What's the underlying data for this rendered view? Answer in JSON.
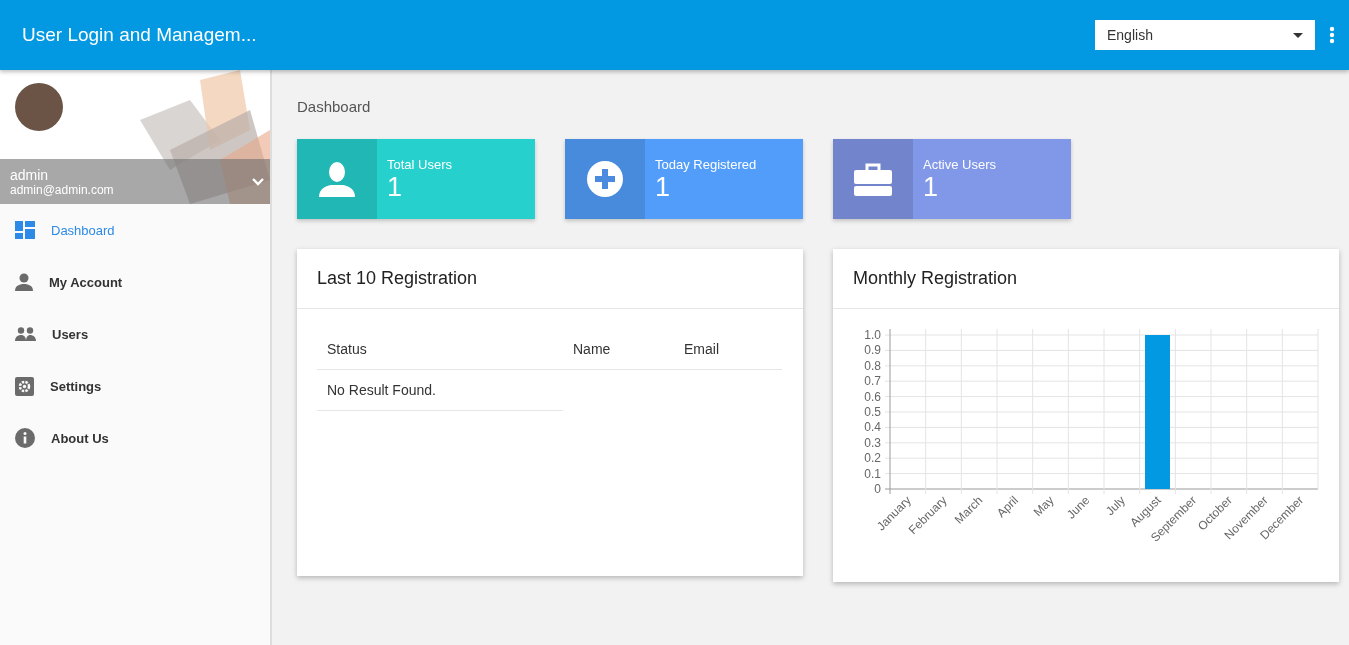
{
  "app_bar": {
    "title": "User Login and Managem...",
    "language": "English"
  },
  "profile": {
    "name": "admin",
    "email": "admin@admin.com"
  },
  "sidebar": {
    "items": [
      {
        "label": "Dashboard",
        "kind": "dashboard",
        "selected": true
      },
      {
        "label": "My Account",
        "kind": "person",
        "selected": false
      },
      {
        "label": "Users",
        "kind": "people",
        "selected": false
      },
      {
        "label": "Settings",
        "kind": "settings",
        "selected": false
      },
      {
        "label": "About Us",
        "kind": "info",
        "selected": false
      }
    ]
  },
  "breadcrumb": "Dashboard",
  "stats": [
    {
      "label": "Total Users",
      "value": "1",
      "kind": "person",
      "color": "#26d0cd"
    },
    {
      "label": "Today Registered",
      "value": "1",
      "kind": "plus",
      "color": "#529dfa"
    },
    {
      "label": "Active Users",
      "value": "1",
      "kind": "briefcase",
      "color": "#8197e8"
    }
  ],
  "registrations": {
    "title": "Last 10 Registration",
    "columns": [
      "Status",
      "Name",
      "Email"
    ],
    "empty": "No Result Found."
  },
  "monthly": {
    "title": "Monthly Registration",
    "chart_data": {
      "type": "bar",
      "categories": [
        "January",
        "February",
        "March",
        "April",
        "May",
        "June",
        "July",
        "August",
        "September",
        "October",
        "November",
        "December"
      ],
      "series": [
        {
          "color": "#0398e2",
          "values": [
            0,
            0,
            0,
            0,
            0,
            0,
            0,
            1,
            0,
            0,
            0,
            0
          ]
        }
      ],
      "grid": true,
      "ylim": [
        0,
        1
      ],
      "yticks": [
        0,
        0.1,
        0.2,
        0.3,
        0.4,
        0.5,
        0.6,
        0.7,
        0.8,
        0.9,
        {
          "value": 1,
          "label": "1.0"
        }
      ]
    }
  }
}
